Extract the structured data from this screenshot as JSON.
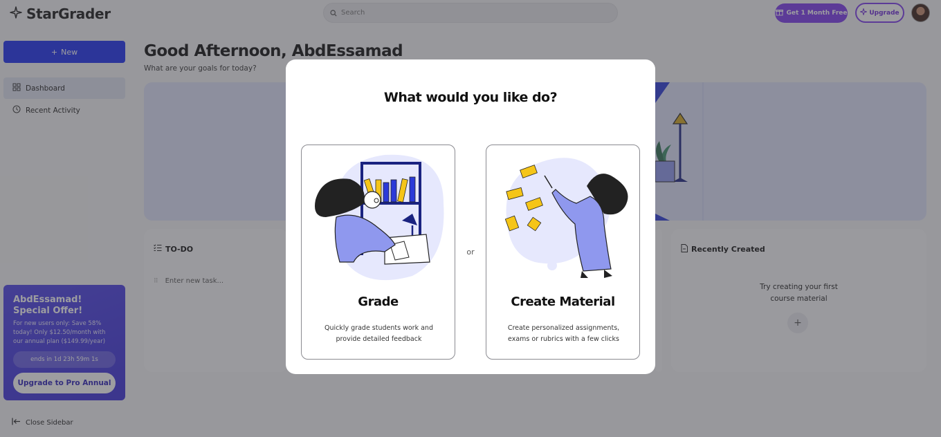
{
  "app": {
    "name": "StarGrader"
  },
  "topbar": {
    "search_placeholder": "Search",
    "free_label": "Get 1 Month Free",
    "upgrade_label": "Upgrade"
  },
  "sidebar": {
    "new_label": "New",
    "items": [
      {
        "label": "Dashboard",
        "icon": "grid-icon",
        "active": true
      },
      {
        "label": "Recent Activity",
        "icon": "clock-icon",
        "active": false
      }
    ],
    "promo": {
      "title": "AbdEssamad! Special Offer!",
      "text": "For new users only: Save 58% today! Only $12.50/month with our annual plan ($149.99/year)",
      "timer": "ends in 1d 23h 59m 1s",
      "button": "Upgrade to Pro Annual"
    },
    "close_label": "Close Sidebar"
  },
  "main": {
    "greeting": "Good Afternoon, AbdEssamad",
    "subtitle": "What are your goals for today?",
    "todo": {
      "title": "TO-DO",
      "placeholder": "Enter new task..."
    },
    "recent": {
      "title": "Recently Created",
      "empty_line1": "Try creating your first",
      "empty_line2": "course material"
    }
  },
  "modal": {
    "title": "What would you like do?",
    "or_label": "or",
    "choices": [
      {
        "title": "Grade",
        "desc": "Quickly grade students work and provide detailed feedback"
      },
      {
        "title": "Create Material",
        "desc": "Create personalized assignments, exams or rubrics with a few clicks"
      }
    ]
  },
  "colors": {
    "accent": "#1d2ff0",
    "purple": "#7c3aed",
    "illustration": "#8f98ee",
    "blob": "#e6e8fd"
  }
}
